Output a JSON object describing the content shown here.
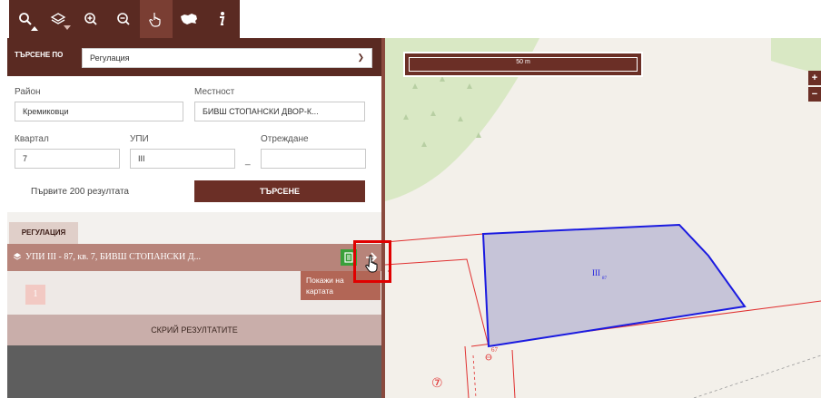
{
  "toolbar": {
    "tools": [
      {
        "name": "search-tool",
        "icon": "magnifier-icon",
        "active": false
      },
      {
        "name": "layers-tool",
        "icon": "layers-icon",
        "active": false
      },
      {
        "name": "zoom-in-tool",
        "icon": "zoom-in-icon",
        "active": false
      },
      {
        "name": "zoom-out-tool",
        "icon": "zoom-out-icon",
        "active": false
      },
      {
        "name": "pan-tool",
        "icon": "hand-pointer-icon",
        "active": true
      },
      {
        "name": "bulgaria-tool",
        "icon": "bulgaria-map-icon",
        "active": false
      },
      {
        "name": "info-tool",
        "icon": "info-icon",
        "active": false
      }
    ]
  },
  "search": {
    "search_by_label": "ТЪРСЕНЕ ПО",
    "search_by_value": "Регулация",
    "rayon_label": "Район",
    "rayon_value": "Кремиковци",
    "mestnost_label": "Местност",
    "mestnost_value": "БИВШ СТОПАНСКИ ДВОР-К...",
    "kvartal_label": "Квартал",
    "kvartal_value": "7",
    "upi_label": "УПИ",
    "upi_value": "III",
    "otrejdane_label": "Отреждане",
    "otrejdane_value": "",
    "dash": "_",
    "limit_note": "Първите 200 резултата",
    "search_button": "ТЪРСЕНЕ"
  },
  "results": {
    "tab_label": "РЕГУЛАЦИЯ",
    "row_text": "УПИ III - 87, кв. 7, БИВШ СТОПАНСКИ Д...",
    "page_number": "1",
    "hide_label": "СКРИЙ РЕЗУЛТАТИТЕ",
    "tooltip_line1": "Покажи на",
    "tooltip_line2": "картата"
  },
  "map": {
    "scale_label": "50 m",
    "zoom_in": "+",
    "zoom_out": "−",
    "parcel_label": "III",
    "parcel_sub": "87",
    "point_label": "67",
    "circle_label": "⑦"
  },
  "colors": {
    "brand_dark": "#5a2a22",
    "accent": "#6b2f26",
    "parcel_fill": "#c6c4d8",
    "parcel_stroke": "#1a1ae0",
    "highlight": "#e00000",
    "green_area": "#d9e8c4"
  }
}
